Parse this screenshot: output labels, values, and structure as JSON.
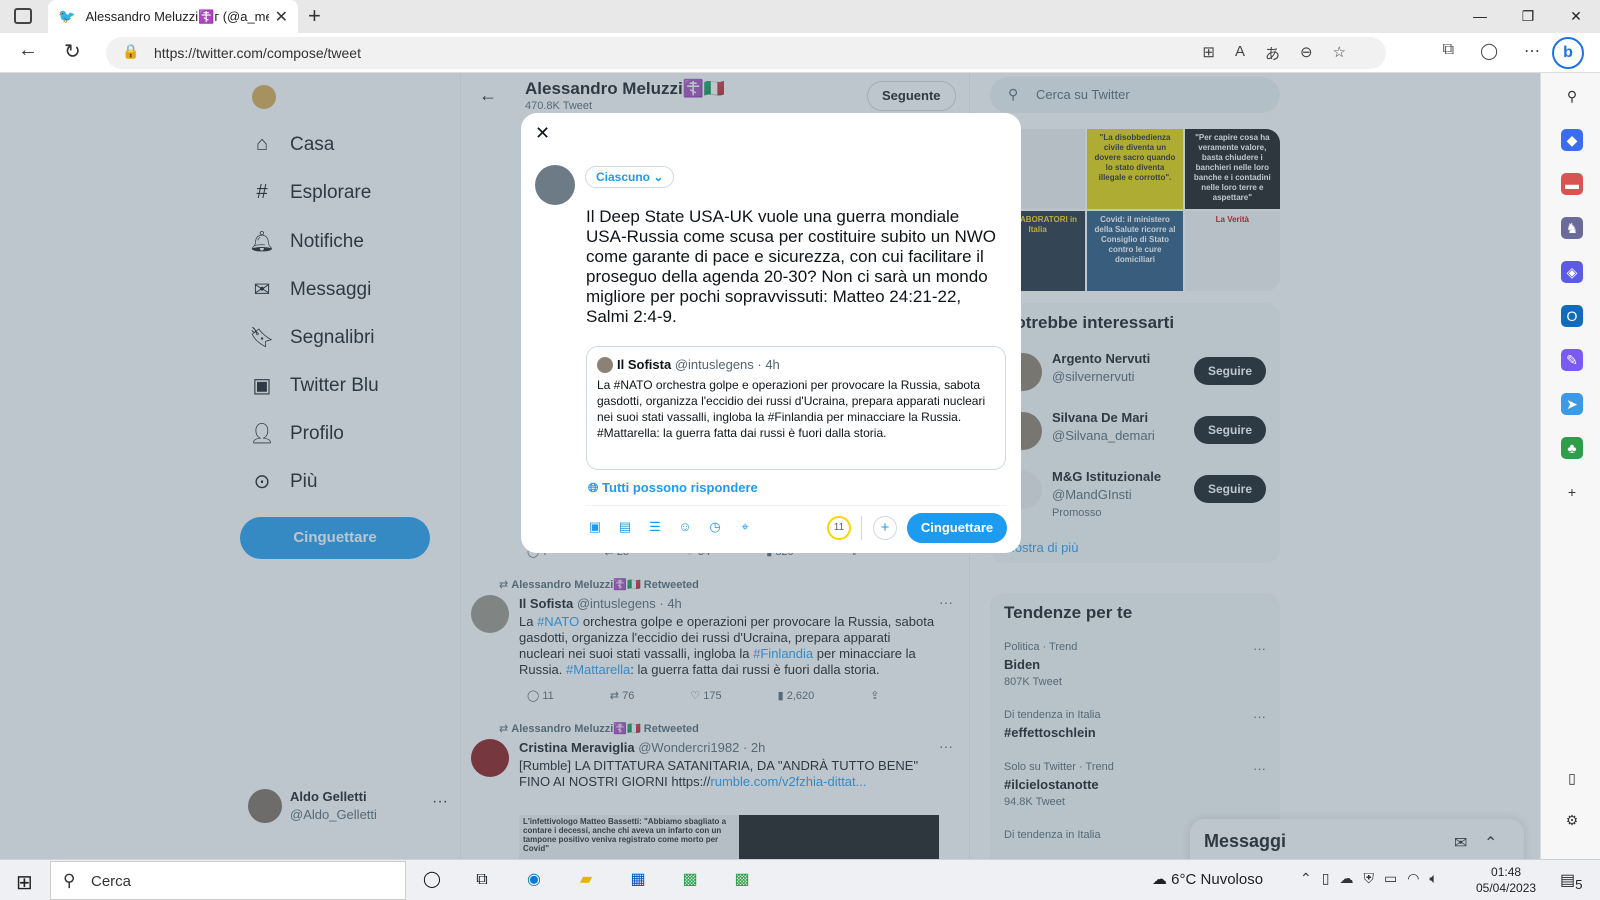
{
  "browser": {
    "tab_title": "Alessandro Meluzzi☦️ᴦ (@a_me",
    "url": "https://twitter.com/compose/tweet"
  },
  "nav": {
    "items": [
      {
        "label": "Casa",
        "icon": "home-icon"
      },
      {
        "label": "Esplorare",
        "icon": "hashtag-icon"
      },
      {
        "label": "Notifiche",
        "icon": "bell-icon"
      },
      {
        "label": "Messaggi",
        "icon": "mail-icon"
      },
      {
        "label": "Segnalibri",
        "icon": "bookmark-icon"
      },
      {
        "label": "Twitter Blu",
        "icon": "twitter-blue-icon"
      },
      {
        "label": "Profilo",
        "icon": "profile-icon"
      },
      {
        "label": "Più",
        "icon": "more-icon"
      }
    ],
    "tweet_button": "Cinguettare"
  },
  "account": {
    "name": "Aldo Gelletti",
    "handle": "@Aldo_Gelletti"
  },
  "profile_header": {
    "name": "Alessandro Meluzzi☦️🇮🇹",
    "tweet_count": "470.8K Tweet",
    "follow_label": "Seguente"
  },
  "feed": {
    "actions_top": {
      "reply": "7",
      "retweet": "23",
      "like": "34",
      "views": "820"
    },
    "tweet1": {
      "retweet_by": "Alessandro Meluzzi☦️🇮🇹 Retweeted",
      "name": "Il Sofista",
      "handle": "@intuslegens · 4h",
      "body_pre": "La ",
      "body_tag1": "#NATO",
      "body_mid": " orchestra golpe e operazioni per provocare la Russia, sabota gasdotti, organizza l'eccidio dei russi d'Ucraina, prepara apparati nucleari nei suoi stati vassalli, ingloba  la ",
      "body_tag2": "#Finlandia",
      "body_mid2": " per minacciare la Russia. ",
      "body_tag3": "#Mattarella",
      "body_end": ": la guerra fatta dai russi è fuori dalla storia.",
      "reply": "11",
      "retweet": "76",
      "like": "175",
      "views": "2,620"
    },
    "tweet2": {
      "retweet_by": "Alessandro Meluzzi☦️🇮🇹 Retweeted",
      "name": "Cristina Meraviglia",
      "handle": "@Wondercri1982 · 2h",
      "body": "[Rumble] LA DITTATURA SATANITARIA, DA \"ANDRÀ TUTTO BENE\" FINO AI NOSTRI GIORNI  https://",
      "link": "rumble.com/v2fzhia-dittat...",
      "media_text": "L'infettivologo Matteo Bassetti: \"Abbiamo sbagliato a contare i decessi, anche chi aveva un infarto con un tampone positivo veniva registrato come morto per Covid\""
    }
  },
  "right": {
    "search_placeholder": "Cerca su Twitter",
    "thumbs": [
      {
        "text": ""
      },
      {
        "text": "\"La disobbedienza civile diventa un dovere sacro quando lo stato diventa illegale e corrotto\"."
      },
      {
        "text": "\"Per capire cosa ha veramente valore, basta chiudere i banchieri nelle loro banche e i contadini nelle loro terre e aspettare\""
      },
      {
        "text": "COLLABORATORI in Italia"
      },
      {
        "text": "Covid: il ministero della Salute ricorre al Consiglio di Stato contro le cure domiciliari"
      },
      {
        "text": "La Verità"
      }
    ],
    "who_title": "Potrebbe interessarti",
    "who": [
      {
        "name": "Argento Nervuti",
        "handle": "@silvernervuti",
        "button": "Seguire"
      },
      {
        "name": "Silvana De Mari",
        "handle": "@Silvana_demari",
        "button": "Seguire"
      },
      {
        "name": "M&G Istituzionale",
        "handle": "@MandGInsti",
        "button": "Seguire",
        "promo": "Promosso"
      }
    ],
    "show_more": "Mostra di più",
    "trends_title": "Tendenze per te",
    "trends": [
      {
        "context": "Politica · Trend",
        "name": "Biden",
        "count": "807K Tweet"
      },
      {
        "context": "Di tendenza in Italia",
        "name": "#effettoschlein",
        "count": ""
      },
      {
        "context": "Solo su Twitter · Trend",
        "name": "#ilcielostanotte",
        "count": "94.8K Tweet"
      },
      {
        "context": "Di tendenza in Italia",
        "name": "",
        "count": ""
      }
    ],
    "messages_dock": "Messaggi"
  },
  "compose": {
    "audience": "Ciascuno",
    "text": "Il Deep State USA-UK vuole una guerra mondiale USA-Russia come scusa per costituire subito un NWO come garante di pace e sicurezza, con cui facilitare il proseguo della agenda 20-30? Non ci sarà un mondo migliore per pochi sopravvissuti: Matteo 24:21-22, Salmi 2:4-9.",
    "quote_name": "Il Sofista",
    "quote_handle": "@intuslegens · 4h",
    "quote_body": "La #NATO orchestra golpe e operazioni per provocare la Russia, sabota gasdotti, organizza l'eccidio dei russi d'Ucraina, prepara apparati nucleari nei suoi stati vassalli, ingloba  la #Finlandia per minacciare la Russia.  #Mattarella: la guerra fatta dai russi è fuori dalla storia.",
    "reply_setting": "Tutti possono rispondere",
    "char_counter": "11",
    "send_label": "Cinguettare"
  },
  "taskbar": {
    "search": "Cerca",
    "weather": "6°C  Nuvoloso",
    "time": "01:48",
    "date": "05/04/2023",
    "notifications": "5"
  }
}
